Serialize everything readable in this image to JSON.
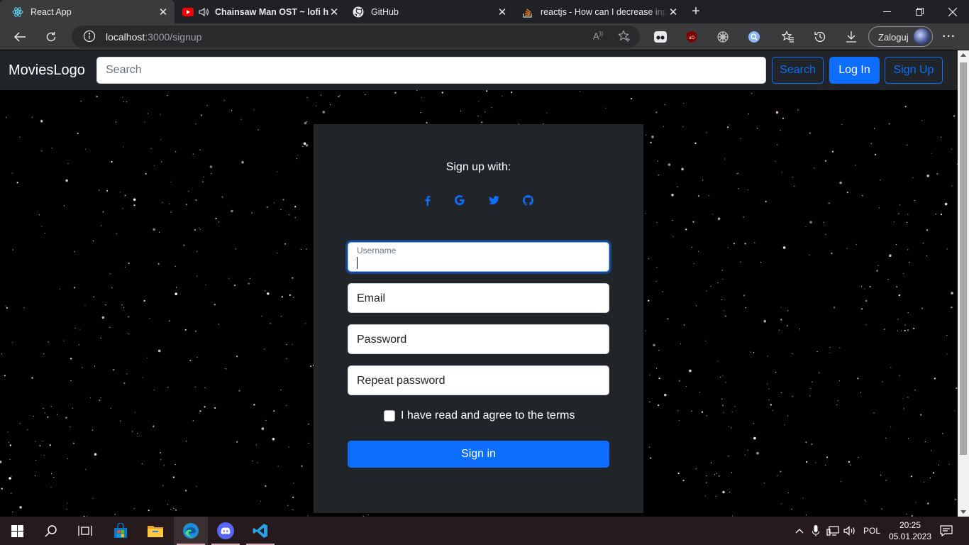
{
  "browser": {
    "tabs": [
      {
        "title": "React App",
        "active": true,
        "icon": "react-icon"
      },
      {
        "title": "Chainsaw Man OST ~ lofi hip hop",
        "active": false,
        "icon": "youtube-icon",
        "audio": true
      },
      {
        "title": "GitHub",
        "active": false,
        "icon": "github-icon"
      },
      {
        "title": "reactjs - How can I decrease input",
        "active": false,
        "icon": "stackoverflow-icon"
      }
    ],
    "url_host": "localhost",
    "url_path": ":3000/signup",
    "profile_label": "Zaloguj"
  },
  "navbar": {
    "logo": "MoviesLogo",
    "search_placeholder": "Search",
    "search_button": "Search",
    "login_button": "Log In",
    "signup_button": "Sign Up"
  },
  "signup": {
    "title": "Sign up with:",
    "social": [
      "facebook-icon",
      "google-icon",
      "twitter-icon",
      "github-icon"
    ],
    "username_label": "Username",
    "email_placeholder": "Email",
    "password_placeholder": "Password",
    "repeat_password_placeholder": "Repeat password",
    "terms_label": "I have read and agree to the terms",
    "submit_label": "Sign in"
  },
  "taskbar": {
    "language": "POL",
    "time": "20:25",
    "date": "05.01.2023"
  },
  "colors": {
    "primary": "#0d6efd",
    "navbar_bg": "#212529",
    "card_bg": "#212529"
  }
}
